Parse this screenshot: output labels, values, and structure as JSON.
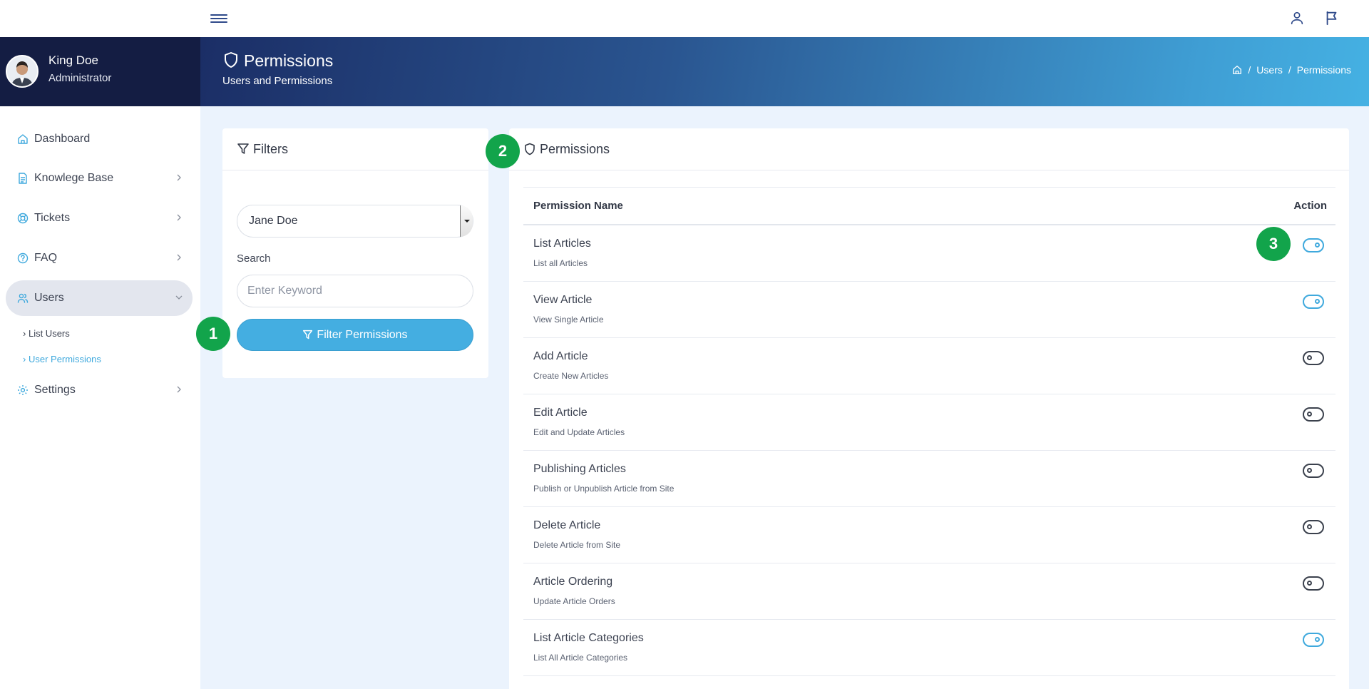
{
  "topbar": {
    "menu_icon": "hamburger-icon",
    "user_icon": "user-icon",
    "flag_icon": "flag-icon"
  },
  "user": {
    "name": "King Doe",
    "role": "Administrator"
  },
  "sidebar": {
    "items": [
      {
        "label": "Dashboard",
        "icon": "home-icon"
      },
      {
        "label": "Knowlege Base",
        "icon": "document-icon"
      },
      {
        "label": "Tickets",
        "icon": "lifebuoy-icon"
      },
      {
        "label": "FAQ",
        "icon": "help-circle-icon"
      },
      {
        "label": "Users",
        "icon": "users-icon"
      },
      {
        "label": "Settings",
        "icon": "gear-icon"
      }
    ],
    "sub_items": [
      {
        "label": "List Users"
      },
      {
        "label": "User Permissions"
      }
    ]
  },
  "header": {
    "title": "Permissions",
    "subtitle": "Users and Permissions",
    "breadcrumb": [
      "Users",
      "Permissions"
    ]
  },
  "filters": {
    "title": "Filters",
    "user_select": "Jane Doe",
    "search_label": "Search",
    "search_placeholder": "Enter Keyword",
    "button_label": "Filter Permissions"
  },
  "permissions": {
    "title": "Permissions",
    "col_name": "Permission Name",
    "col_action": "Action",
    "rows": [
      {
        "name": "List Articles",
        "desc": "List all Articles",
        "enabled": true
      },
      {
        "name": "View Article",
        "desc": "View Single Article",
        "enabled": true
      },
      {
        "name": "Add Article",
        "desc": "Create New Articles",
        "enabled": false
      },
      {
        "name": "Edit Article",
        "desc": "Edit and Update Articles",
        "enabled": false
      },
      {
        "name": "Publishing Articles",
        "desc": "Publish or Unpublish Article from Site",
        "enabled": false
      },
      {
        "name": "Delete Article",
        "desc": "Delete Article from Site",
        "enabled": false
      },
      {
        "name": "Article Ordering",
        "desc": "Update Article Orders",
        "enabled": false
      },
      {
        "name": "List Article Categories",
        "desc": "List All Article Categories",
        "enabled": true
      }
    ]
  },
  "markers": [
    "1",
    "2",
    "3"
  ],
  "colors": {
    "accent": "#44aee1",
    "sidebar_dark": "#141d43",
    "marker_green": "#12a44b",
    "content_bg": "#ebf3fd"
  }
}
